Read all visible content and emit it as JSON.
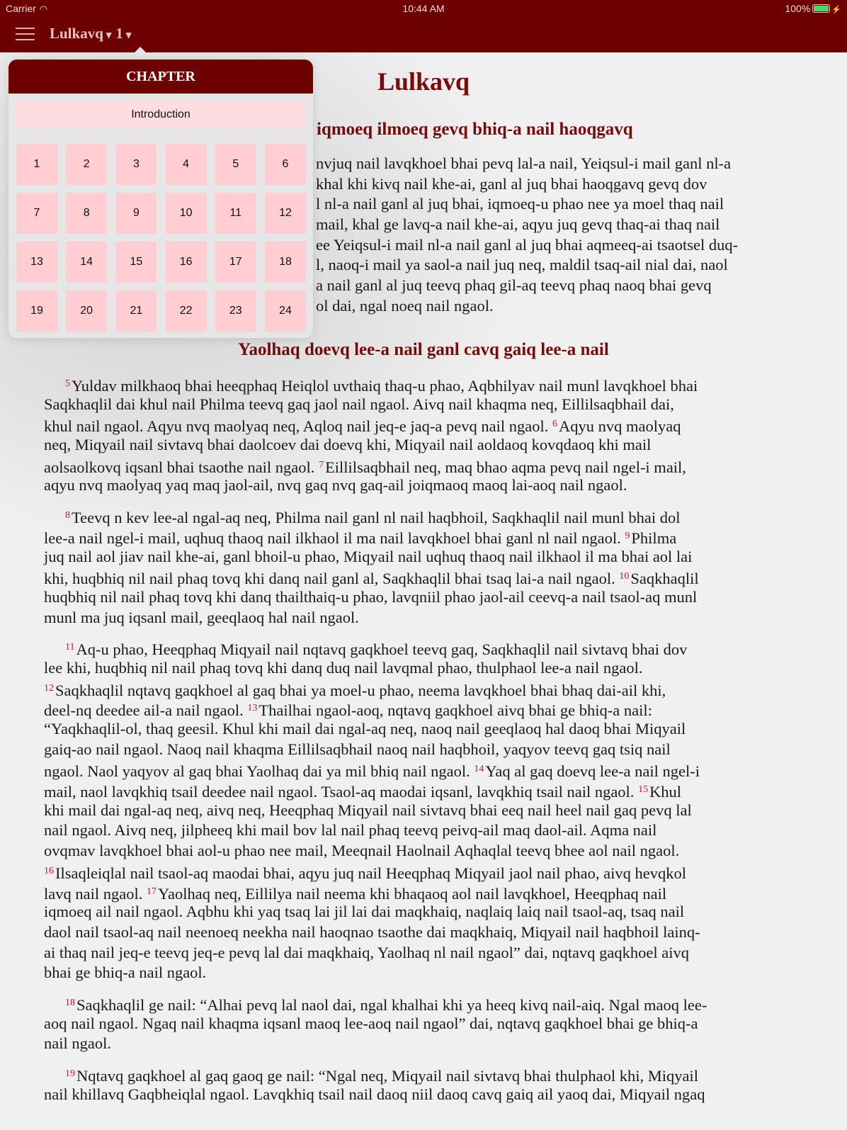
{
  "status": {
    "carrier": "Carrier",
    "time": "10:44 AM",
    "battery": "100%"
  },
  "nav": {
    "book": "Lulkavq",
    "chapter": "1",
    "caret": "▾"
  },
  "popover": {
    "header": "CHAPTER",
    "intro": "Introduction",
    "chapters": [
      "1",
      "2",
      "3",
      "4",
      "5",
      "6",
      "7",
      "8",
      "9",
      "10",
      "11",
      "12",
      "13",
      "14",
      "15",
      "16",
      "17",
      "18",
      "19",
      "20",
      "21",
      "22",
      "23",
      "24"
    ]
  },
  "colors": {
    "bar": "#6d0000",
    "heading": "#7a0a0a",
    "verse": "#c8161d",
    "chapter_cell": "#ffcdd2",
    "intro_button": "#ffdce0"
  },
  "content": {
    "title": "Lulkavq",
    "section1": {
      "heading": "iqmoeq ilmoeq gevq bhiq-a nail haoqgavq",
      "lines": [
        "nvjuq nail lavqkhoel bhai pevq lal-a nail, Yeiqsul-i mail ganl nl-a",
        "khal khi kivq nail khe-ai, ganl al juq bhai haoqgavq gevq dov",
        "l nl-a nail ganl al juq bhai, iqmoeq-u phao nee ya moel thaq nail",
        "mail, khal ge lavq-a nail khe-ai, aqyu juq gevq thaq-ai thaq nail",
        "ee Yeiqsul-i mail nl-a nail ganl al juq bhai aqmeeq-ai tsaotsel duq-",
        "l, naoq-i mail ya saol-a nail juq neq, maldil tsaq-ail nial dai, naol",
        "a nail ganl al juq teevq phaq gil-aq teevq phaq naoq bhai gevq",
        "ol dai, ngal noeq nail ngaol."
      ]
    },
    "section2": {
      "heading": "Yaolhaq doevq lee-a nail ganl cavq gaiq lee-a nail",
      "paragraphs": [
        [
          [
            {
              "verse": "5"
            },
            "Yuldav milkhaoq bhai heeqphaq Heiqlol uvthaiq thaq-u phao, Aqbhilyav nail munl lavqkhoel bhai"
          ],
          [
            "Saqkhaqlil dai khul nail Philma teevq gaq jaol nail ngaol. Aivq nail khaqma neq, Eillilsaqbhail dai,"
          ],
          [
            "khul nail ngaol. Aqyu nvq maolyaq neq, Aqloq nail jeq-e jaq-a pevq nail ngaol. ",
            {
              "verse": "6"
            },
            "Aqyu nvq maolyaq"
          ],
          [
            "neq, Miqyail nail sivtavq bhai daolcoev dai doevq khi, Miqyail nail aoldaoq kovqdaoq khi mail"
          ],
          [
            "aolsaolkovq iqsanl bhai tsaothe nail ngaol. ",
            {
              "verse": "7"
            },
            "Eillilsaqbhail neq, maq bhao aqma pevq nail ngel-i mail,"
          ],
          [
            "aqyu nvq maolyaq yaq maq jaol-ail, nvq gaq nvq gaq-ail joiqmaoq maoq lai-aoq nail ngaol."
          ]
        ],
        [
          [
            {
              "verse": "8"
            },
            "Teevq n kev lee-al ngal-aq neq, Philma nail ganl nl nail haqbhoil, Saqkhaqlil nail munl bhai dol"
          ],
          [
            "lee-a nail ngel-i mail, uqhuq thaoq nail ilkhaol il ma nail lavqkhoel bhai ganl nl nail ngaol. ",
            {
              "verse": "9"
            },
            "Philma"
          ],
          [
            "juq nail aol jiav nail khe-ai, ganl bhoil-u phao, Miqyail nail uqhuq thaoq nail ilkhaol il ma bhai aol lai"
          ],
          [
            "khi, huqbhiq nil nail phaq tovq khi danq nail ganl al, Saqkhaqlil bhai tsaq lai-a nail ngaol. ",
            {
              "verse": "10"
            },
            "Saqkhaqlil"
          ],
          [
            "huqbhiq nil nail phaq tovq khi danq thailthaiq-u phao, lavqniil phao jaol-ail ceevq-a nail tsaol-aq munl"
          ],
          [
            "munl ma juq iqsanl mail, geeqlaoq hal nail ngaol."
          ]
        ],
        [
          [
            {
              "verse": "11"
            },
            "Aq-u phao, Heeqphaq Miqyail nail nqtavq gaqkhoel teevq gaq, Saqkhaqlil nail sivtavq bhai dov"
          ],
          [
            "lee khi, huqbhiq nil nail phaq tovq khi danq duq nail lavqmal phao, thulphaol lee-a nail ngaol."
          ],
          [
            {
              "verse": "12"
            },
            "Saqkhaqlil nqtavq gaqkhoel al gaq bhai ya moel-u phao, neema lavqkhoel bhai bhaq dai-ail khi,"
          ],
          [
            "deel-nq deedee ail-a nail ngaol. ",
            {
              "verse": "13"
            },
            "Thailhai ngaol-aoq, nqtavq gaqkhoel aivq bhai ge bhiq-a nail:"
          ],
          [
            "“Yaqkhaqlil-ol, thaq geesil. Khul khi mail dai ngal-aq neq, naoq nail geeqlaoq hal daoq bhai Miqyail"
          ],
          [
            "gaiq-ao nail ngaol. Naoq nail khaqma Eillilsaqbhail naoq nail haqbhoil, yaqyov teevq gaq tsiq nail"
          ],
          [
            "ngaol. Naol yaqyov al gaq bhai Yaolhaq dai ya mil bhiq nail ngaol. ",
            {
              "verse": "14"
            },
            "Yaq al gaq doevq lee-a nail ngel-i"
          ],
          [
            "mail, naol lavqkhiq tsail deedee nail ngaol. Tsaol-aq maodai iqsanl, lavqkhiq tsail nail ngaol. ",
            {
              "verse": "15"
            },
            "Khul"
          ],
          [
            "khi mail dai ngal-aq neq, aivq neq, Heeqphaq Miqyail nail sivtavq bhai eeq nail heel nail gaq pevq lal"
          ],
          [
            "nail ngaol. Aivq neq, jilpheeq khi mail bov lal nail phaq teevq peivq-ail maq daol-ail. Aqma nail"
          ],
          [
            "ovqmav lavqkhoel bhai aol-u phao nee mail, Meeqnail Haolnail Aqhaqlal teevq bhee aol nail ngaol."
          ],
          [
            {
              "verse": "16"
            },
            "Ilsaqleiqlal nail tsaol-aq maodai bhai, aqyu juq nail Heeqphaq Miqyail jaol nail phao, aivq hevqkol"
          ],
          [
            "lavq nail ngaol. ",
            {
              "verse": "17"
            },
            "Yaolhaq neq, Eillilya nail neema khi bhaqaoq aol nail lavqkhoel, Heeqphaq nail"
          ],
          [
            "iqmoeq ail nail ngaol. Aqbhu khi yaq tsaq lai jil lai dai maqkhaiq, naqlaiq laiq nail tsaol-aq, tsaq nail"
          ],
          [
            "daol nail tsaol-aq nail neenoeq neekha nail haoqnao tsaothe dai maqkhaiq, Miqyail nail haqbhoil lainq-"
          ],
          [
            "ai thaq nail jeq-e teevq jeq-e pevq lal dai maqkhaiq, Yaolhaq nl nail ngaol” dai, nqtavq gaqkhoel aivq"
          ],
          [
            "bhai ge bhiq-a nail ngaol."
          ]
        ],
        [
          [
            {
              "verse": "18"
            },
            "Saqkhaqlil ge nail: “Alhai pevq lal naol dai, ngal khalhai khi ya heeq kivq nail-aiq. Ngal maoq lee-"
          ],
          [
            "aoq nail ngaol. Ngaq nail khaqma iqsanl maoq lee-aoq nail ngaol” dai, nqtavq gaqkhoel bhai ge bhiq-a"
          ],
          [
            "nail ngaol."
          ]
        ],
        [
          [
            {
              "verse": "19"
            },
            "Nqtavq gaqkhoel al gaq gaoq ge nail: “Ngal neq, Miqyail nail sivtavq bhai thulphaol khi, Miqyail"
          ],
          [
            "nail khillavq Gaqbheiqlal ngaol. Lavqkhiq tsail nail daoq niil daoq cavq gaiq ail yaoq dai, Miqyail ngaq"
          ]
        ]
      ]
    }
  }
}
